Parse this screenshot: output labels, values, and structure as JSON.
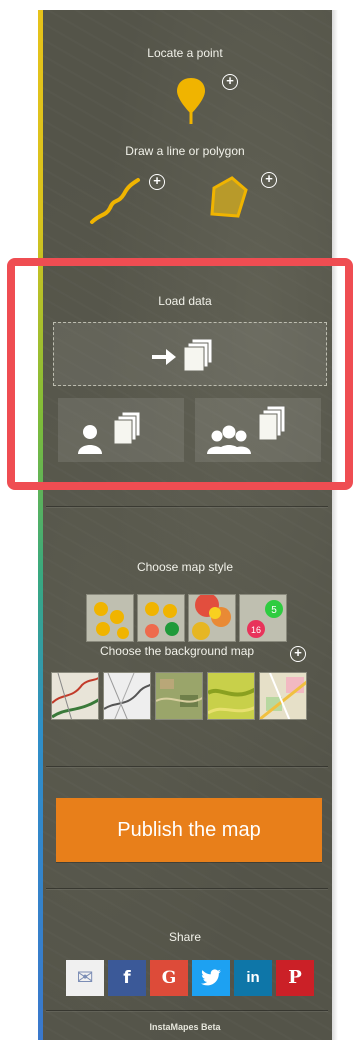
{
  "tools": {
    "locate_label": "Locate a point",
    "draw_label": "Draw a line or polygon"
  },
  "load": {
    "title": "Load data"
  },
  "style": {
    "title": "Choose map style",
    "background_title": "Choose the background map",
    "cluster_numbers": [
      "5",
      "16"
    ]
  },
  "publish": {
    "label": "Publish the map"
  },
  "share": {
    "title": "Share",
    "buttons": [
      {
        "glyph": "✉",
        "color": "#f0f0f0"
      },
      {
        "glyph": "f",
        "color": "#3b5998"
      },
      {
        "glyph": "G",
        "color": "#dd4b39"
      },
      {
        "glyph": "t",
        "color": "#1da1f2"
      },
      {
        "glyph": "in",
        "color": "#0e76a8"
      },
      {
        "glyph": "P",
        "color": "#cb2027"
      }
    ]
  },
  "footer": {
    "text": "InstaMapes Beta"
  },
  "colors": {
    "accent_orange": "#e87f1a",
    "marker_yellow": "#f0b400",
    "highlight_red": "#ef4d52"
  }
}
